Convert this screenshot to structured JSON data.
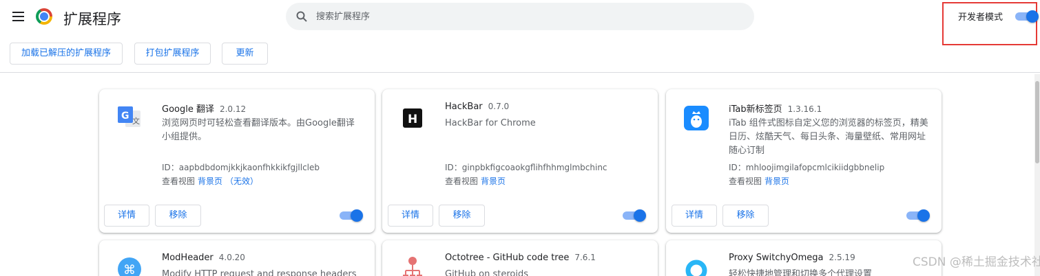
{
  "header": {
    "title": "扩展程序",
    "search_placeholder": "搜索扩展程序",
    "dev_mode_label": "开发者模式",
    "dev_mode_on": true
  },
  "toolbar": {
    "load_unpacked": "加载已解压的扩展程序",
    "pack": "打包扩展程序",
    "update": "更新"
  },
  "extensions": [
    {
      "name": "Google 翻译",
      "version": "2.0.12",
      "description": "浏览网页时可轻松查看翻译版本。由Google翻译小组提供。",
      "id": "ID：aapbdbdomjkkjkaonfhkkikfgjllcleb",
      "views_label": "查看视图",
      "background_link": "背景页",
      "inactive_link": "（无效）",
      "details": "详情",
      "remove": "移除",
      "enabled": true,
      "icon": "google-translate-icon"
    },
    {
      "name": "HackBar",
      "version": "0.7.0",
      "description": "HackBar for Chrome",
      "id": "ID：ginpbkfigcoaokgflihfhhmglmbchinc",
      "views_label": "查看视图",
      "background_link": "背景页",
      "details": "详情",
      "remove": "移除",
      "enabled": true,
      "icon": "hackbar-icon"
    },
    {
      "name": "iTab新标签页",
      "version": "1.3.16.1",
      "description": "iTab 组件式图标自定义您的浏览器的标签页，精美日历、炫酷天气、每日头条、海量壁纸、常用网址随心订制",
      "id": "ID：mhloojimgilafopcmlcikiidgbbnelip",
      "views_label": "查看视图",
      "background_link": "背景页",
      "details": "详情",
      "remove": "移除",
      "enabled": true,
      "icon": "itab-icon"
    },
    {
      "name": "ModHeader",
      "version": "4.0.20",
      "description": "Modify HTTP request and response headers",
      "icon": "modheader-icon"
    },
    {
      "name": "Octotree - GitHub code tree",
      "version": "7.6.1",
      "description": "GitHub on steroids",
      "icon": "octotree-icon"
    },
    {
      "name": "Proxy SwitchyOmega",
      "version": "2.5.19",
      "description": "轻松快捷地管理和切换多个代理设置",
      "icon": "switchyomega-icon"
    }
  ],
  "watermark": "CSDN @稀土掘金技术社区",
  "colors": {
    "accent": "#1a73e8",
    "highlight_box": "#e53935"
  }
}
